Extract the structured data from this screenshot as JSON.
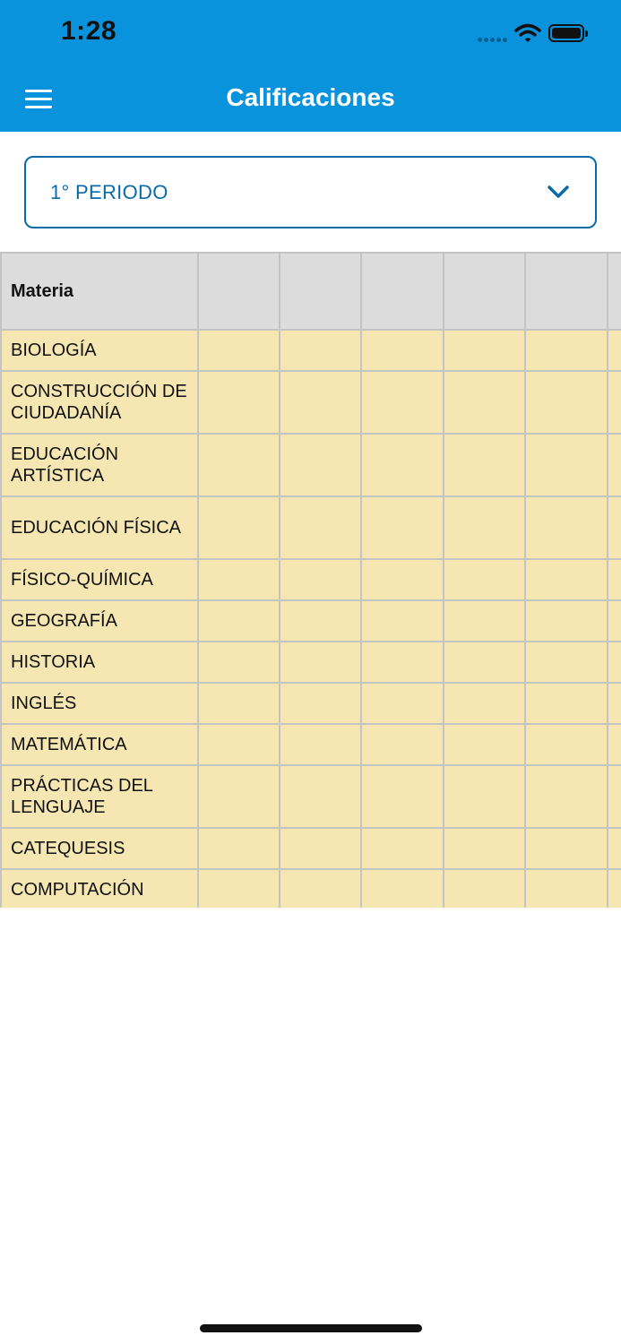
{
  "status_bar": {
    "time": "1:28"
  },
  "header": {
    "title": "Calificaciones",
    "menu_icon": "hamburger-menu-icon",
    "background_color": "#0a93dd"
  },
  "period_selector": {
    "selected": "1° PERIODO",
    "icon": "chevron-down-icon",
    "accent_color": "#0a6aa8"
  },
  "grades_table": {
    "columns": [
      "Materia",
      "",
      "",
      "",
      "",
      "",
      ""
    ],
    "rows": [
      {
        "subject": "BIOLOGÍA",
        "grades": [
          "",
          "",
          "",
          "",
          "",
          ""
        ]
      },
      {
        "subject": "CONSTRUCCIÓN DE CIUDADANÍA",
        "grades": [
          "",
          "",
          "",
          "",
          "",
          ""
        ]
      },
      {
        "subject": "EDUCACIÓN ARTÍSTICA",
        "grades": [
          "",
          "",
          "",
          "",
          "",
          ""
        ]
      },
      {
        "subject": "EDUCACIÓN FÍSICA",
        "grades": [
          "",
          "",
          "",
          "",
          "",
          ""
        ]
      },
      {
        "subject": "FÍSICO-QUÍMICA",
        "grades": [
          "",
          "",
          "",
          "",
          "",
          ""
        ]
      },
      {
        "subject": "GEOGRAFÍA",
        "grades": [
          "",
          "",
          "",
          "",
          "",
          ""
        ]
      },
      {
        "subject": "HISTORIA",
        "grades": [
          "",
          "",
          "",
          "",
          "",
          ""
        ]
      },
      {
        "subject": "INGLÉS",
        "grades": [
          "",
          "",
          "",
          "",
          "",
          ""
        ]
      },
      {
        "subject": "MATEMÁTICA",
        "grades": [
          "",
          "",
          "",
          "",
          "",
          ""
        ]
      },
      {
        "subject": "PRÁCTICAS DEL LENGUAJE",
        "grades": [
          "",
          "",
          "",
          "",
          "",
          ""
        ]
      },
      {
        "subject": "CATEQUESIS",
        "grades": [
          "",
          "",
          "",
          "",
          "",
          ""
        ]
      },
      {
        "subject": "COMPUTACIÓN",
        "grades": [
          "",
          "",
          "",
          "",
          "",
          ""
        ]
      }
    ],
    "header_color": "#dcdcdc",
    "row_color": "#f6e7b2"
  }
}
